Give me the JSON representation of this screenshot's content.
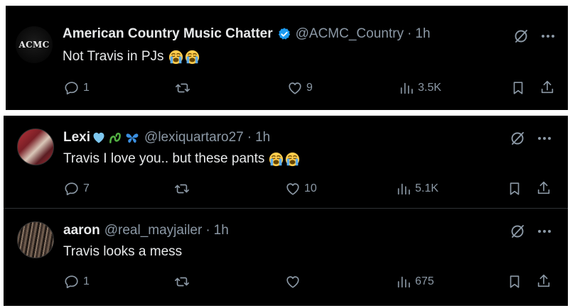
{
  "tweets": [
    {
      "avatar_text": "ACMC",
      "name": "American Country Music Chatter",
      "verified": true,
      "handle": "@ACMC_Country",
      "separator": "·",
      "time": "1h",
      "text": "Not Travis in PJs",
      "emojis": [
        "loudly-crying-face",
        "loudly-crying-face"
      ],
      "replies": "1",
      "retweets": "",
      "likes": "9",
      "views": "3.5K"
    },
    {
      "name": "Lexi",
      "name_emojis": [
        "light-blue-heart",
        "green-knot",
        "blue-butterfly"
      ],
      "handle": "@lexiquartaro27",
      "separator": "·",
      "time": "1h",
      "text": "Travis I love you.. but these pants",
      "emojis": [
        "loudly-crying-face",
        "loudly-crying-face"
      ],
      "replies": "7",
      "retweets": "",
      "likes": "10",
      "views": "5.1K"
    },
    {
      "name": "aaron",
      "handle": "@real_mayjailer",
      "separator": "·",
      "time": "1h",
      "text": "Travis looks a mess",
      "replies": "1",
      "retweets": "",
      "likes": "",
      "views": "675"
    }
  ],
  "colors": {
    "background": "#000000",
    "text": "#e7e9ea",
    "muted": "#8b98a5",
    "verified": "#1d9bf0"
  }
}
